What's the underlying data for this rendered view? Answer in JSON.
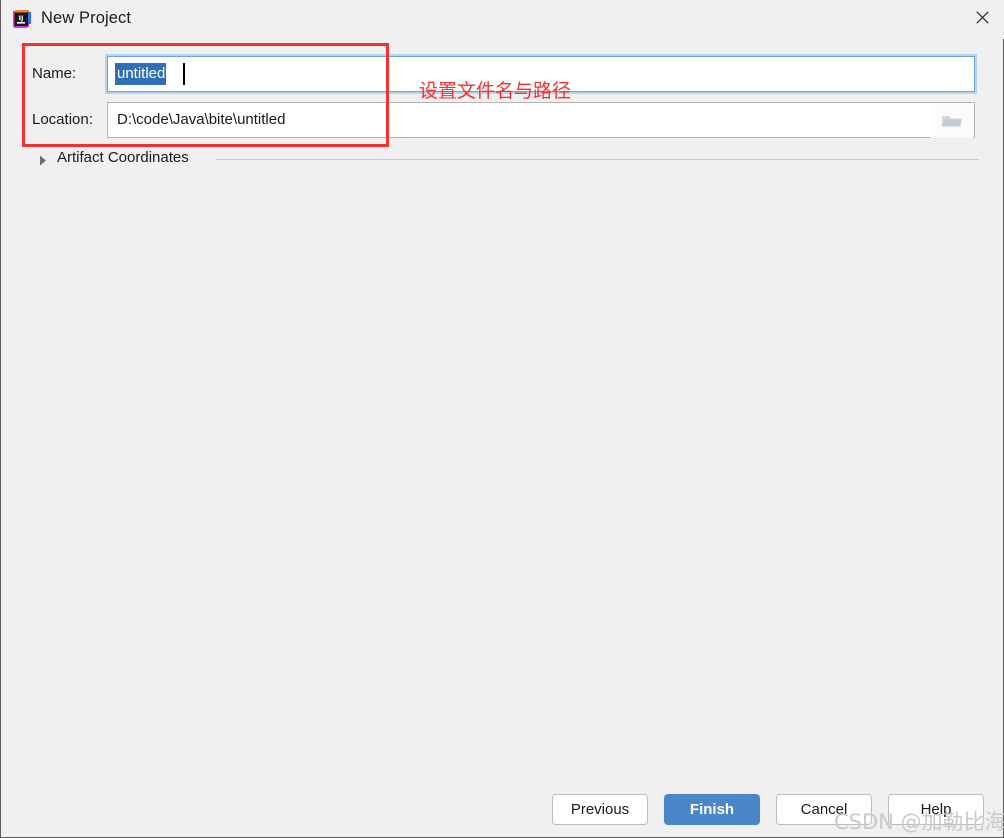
{
  "window": {
    "title": "New Project",
    "app_icon": "intellij-idea-icon",
    "close_icon": "close-icon"
  },
  "form": {
    "name_field": {
      "label": "Name:",
      "value": "untitled",
      "selected": true,
      "focused": true
    },
    "location_field": {
      "label": "Location:",
      "value": "D:\\code\\Java\\bite\\untitled",
      "browse_icon": "folder-icon"
    }
  },
  "expander": {
    "label": "Artifact Coordinates",
    "arrow_icon": "chevron-right-icon",
    "expanded": false
  },
  "annotation": {
    "text": "设置文件名与路径",
    "color": "#f2322f"
  },
  "buttons": {
    "previous": "Previous",
    "finish": "Finish",
    "cancel": "Cancel",
    "help": "Help"
  },
  "watermark": {
    "text": "CSDN @加勒比海涛"
  },
  "colors": {
    "dialog_bg": "#f0f0f0",
    "primary_button": "#4a86c8",
    "focus_ring": "#b6d4ef",
    "selection": "#2f6fb5",
    "annotation_red": "#f2322f"
  }
}
